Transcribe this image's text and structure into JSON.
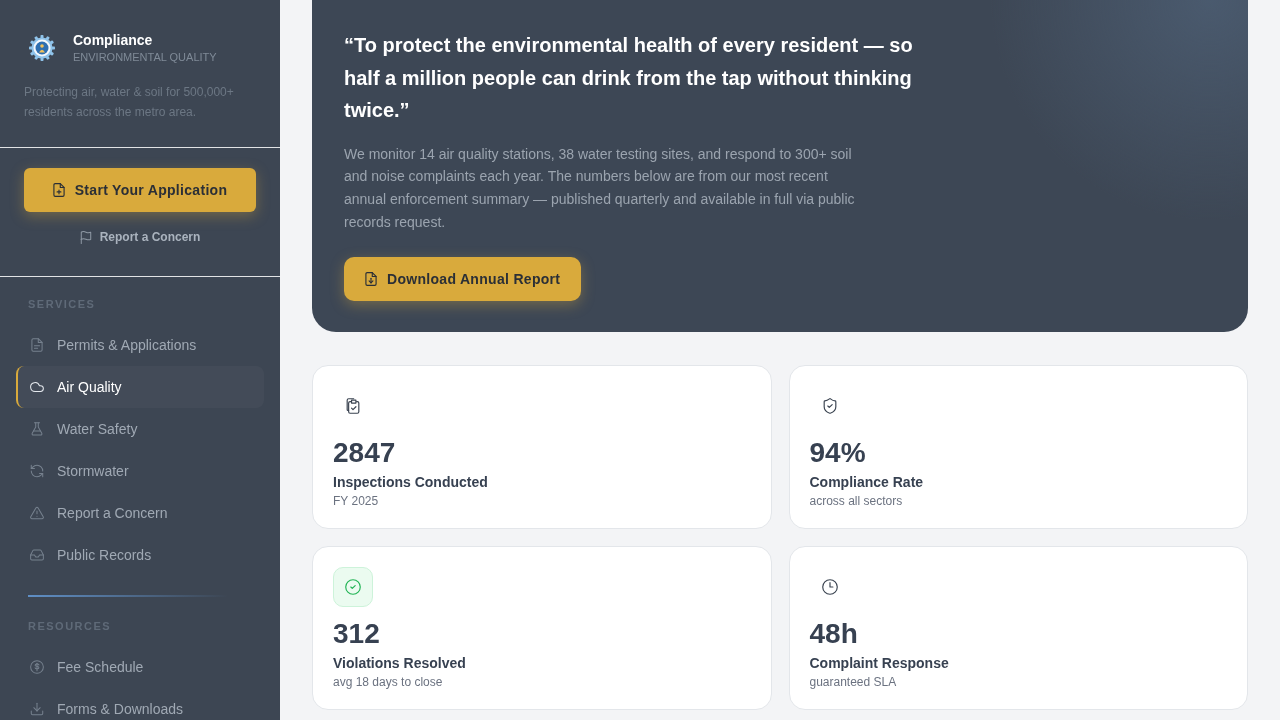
{
  "sidebar": {
    "brand": {
      "title": "Compliance",
      "subtitle": "ENVIRONMENTAL QUALITY"
    },
    "tagline": "Protecting air, water & soil for 500,000+ residents across the metro area.",
    "primary_button": "Start Your Application",
    "secondary_link": "Report a Concern",
    "sections": [
      {
        "heading": "SERVICES",
        "items": [
          {
            "label": "Permits & Applications",
            "selected": false
          },
          {
            "label": "Air Quality",
            "selected": true
          },
          {
            "label": "Water Safety",
            "selected": false
          },
          {
            "label": "Stormwater",
            "selected": false
          },
          {
            "label": "Report a Concern",
            "selected": false
          },
          {
            "label": "Public Records",
            "selected": false
          }
        ]
      },
      {
        "heading": "RESOURCES",
        "items": [
          {
            "label": "Fee Schedule",
            "selected": false
          },
          {
            "label": "Forms & Downloads",
            "selected": false
          }
        ]
      }
    ]
  },
  "hero": {
    "quote": "“To protect the environmental health of every resident — so half a million people can drink from the tap without thinking twice.”",
    "body": "We monitor 14 air quality stations, 38 water testing sites, and respond to 300+ soil and noise complaints each year. The numbers below are from our most recent annual enforcement summary — published quarterly and available in full via public records request.",
    "button": "Download Annual Report"
  },
  "stats": [
    {
      "value": "2847",
      "label": "Inspections Conducted",
      "note": "FY 2025",
      "highlighted": false
    },
    {
      "value": "94%",
      "label": "Compliance Rate",
      "note": "across all sectors",
      "highlighted": false
    },
    {
      "value": "312",
      "label": "Violations Resolved",
      "note": "avg 18 days to close",
      "highlighted": true
    },
    {
      "value": "48h",
      "label": "Complaint Response",
      "note": "guaranteed SLA",
      "highlighted": false
    }
  ]
}
